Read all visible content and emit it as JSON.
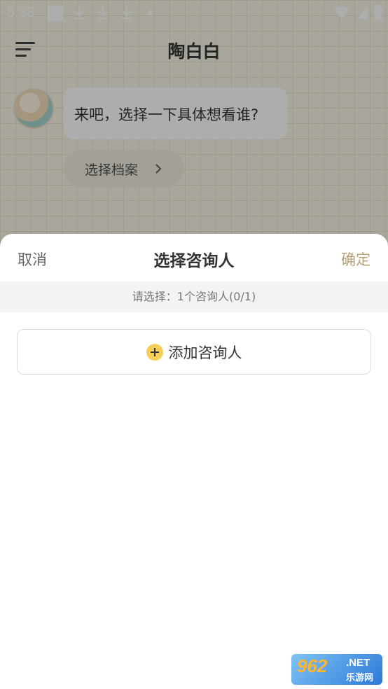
{
  "status_bar": {
    "time": "5:33",
    "icons": [
      "notification-square-icon",
      "download-icon",
      "download-icon",
      "download-icon",
      "dot-icon",
      "wifi-icon",
      "signal-icon",
      "battery-icon"
    ]
  },
  "header": {
    "title": "陶白白",
    "menu_icon": "menu-icon"
  },
  "chat": {
    "message": "来吧，选择一下具体想看谁?",
    "select_button": "选择档案"
  },
  "sheet": {
    "cancel_label": "取消",
    "title": "选择咨询人",
    "confirm_label": "确定",
    "info_text": "请选择：1个咨询人(0/1)",
    "add_label": "添加咨询人"
  },
  "watermark": {
    "number": "962",
    "suffix": ".NET",
    "subtitle": "乐游网"
  },
  "colors": {
    "confirm": "#b9a27a",
    "add_icon": "#f7cf58",
    "overlay": "rgba(40,40,40,0.38)"
  }
}
